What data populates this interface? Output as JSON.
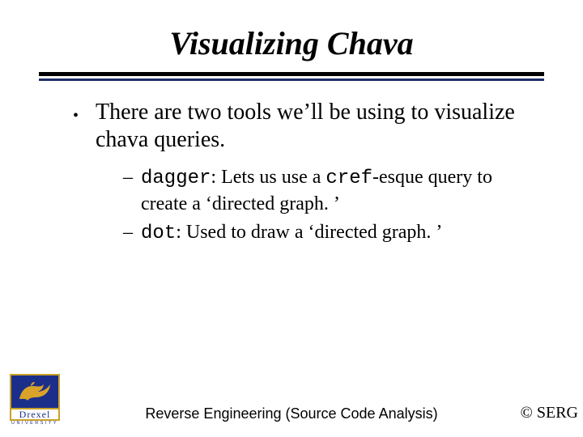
{
  "title": "Visualizing Chava",
  "bullets": [
    {
      "text": "There are two tools we’ll be using to visualize chava queries.",
      "sub": [
        {
          "code": "dagger",
          "sep": ":  Lets us use a ",
          "code2": "cref",
          "rest": "-esque query to create a ‘directed graph. ’"
        },
        {
          "code": "dot",
          "sep": ":  Used to draw a ‘directed graph. ’",
          "code2": "",
          "rest": ""
        }
      ]
    }
  ],
  "footer": {
    "center": "Reverse Engineering (Source Code Analysis)",
    "right": "© SERG"
  },
  "logo": {
    "name": "Drexel",
    "sub": "UNIVERSITY"
  }
}
